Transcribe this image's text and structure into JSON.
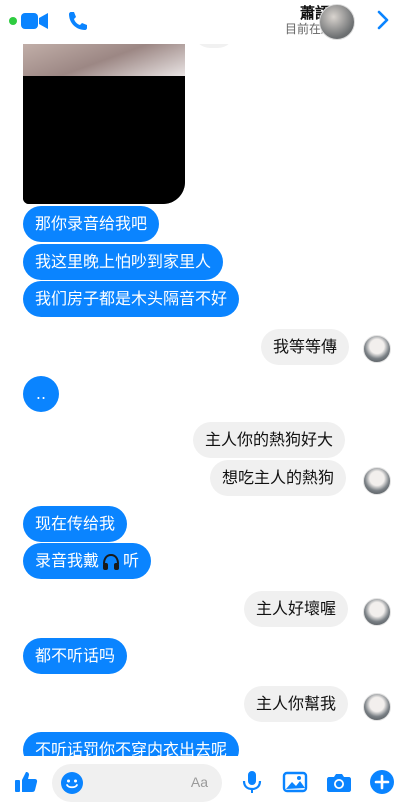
{
  "header": {
    "name": "蕭語珊",
    "status": "目前在線上"
  },
  "messages": [
    {
      "side": "out",
      "text": "那你录音给我吧"
    },
    {
      "side": "out",
      "text": "我这里晚上怕吵到家里人"
    },
    {
      "side": "out",
      "text": "我们房子都是木头隔音不好"
    },
    {
      "side": "in",
      "text": "我等等傳"
    },
    {
      "side": "out",
      "text": ".."
    },
    {
      "side": "in",
      "text": "主人你的熱狗好大"
    },
    {
      "side": "in",
      "text": "想吃主人的熱狗"
    },
    {
      "side": "out",
      "text": "现在传给我"
    },
    {
      "side": "out",
      "text_before": "录音我戴",
      "text_after": "听"
    },
    {
      "side": "in",
      "text": "主人好壞喔"
    },
    {
      "side": "out",
      "text": "都不听话吗"
    },
    {
      "side": "in",
      "text": "主人你幫我"
    },
    {
      "side": "out",
      "text": "不听话罚你不穿内衣出去呢"
    }
  ],
  "composer": {
    "placeholder": "Aa"
  },
  "colors": {
    "accent": "#0a84ff",
    "incoming_bubble": "#f0f0f0"
  },
  "icons": [
    "dot-icon",
    "video-call-icon",
    "phone-icon",
    "back-chevron-icon",
    "thumbs-up-icon",
    "emoji-icon",
    "microphone-icon",
    "gallery-icon",
    "camera-icon",
    "add-icon",
    "headphones-icon"
  ]
}
